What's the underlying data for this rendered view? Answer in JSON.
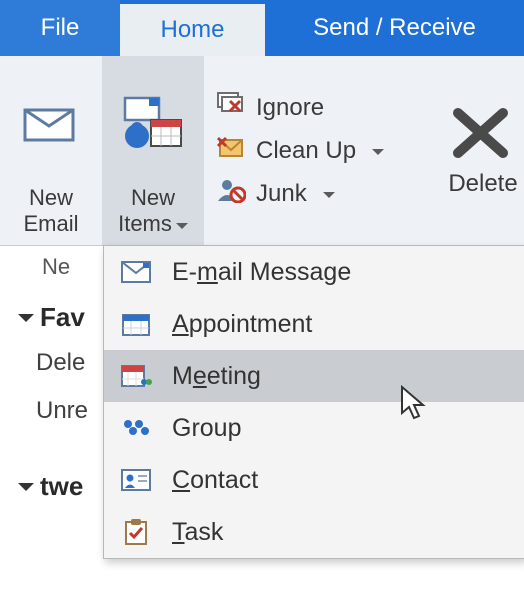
{
  "tabs": {
    "file": "File",
    "home": "Home",
    "sendrec": "Send / Receive"
  },
  "ribbon": {
    "new_email_l1": "New",
    "new_email_l2": "Email",
    "new_items_l1": "New",
    "new_items_l2": "Items",
    "ignore": "Ignore",
    "cleanup": "Clean Up",
    "junk": "Junk",
    "delete": "Delete"
  },
  "nav": {
    "header_small": "Ne",
    "group1": "Fav",
    "item1": "Dele",
    "item2": "Unre",
    "group2": "twe"
  },
  "menu": {
    "email_pre": "E-",
    "email_accel": "m",
    "email_post": "ail Message",
    "appt_accel": "A",
    "appt_post": "ppointment",
    "meeting_pre": "M",
    "meeting_accel": "e",
    "meeting_post": "eting",
    "group_label": "Group",
    "contact_accel": "C",
    "contact_post": "ontact",
    "task_accel": "T",
    "task_post": "ask"
  }
}
